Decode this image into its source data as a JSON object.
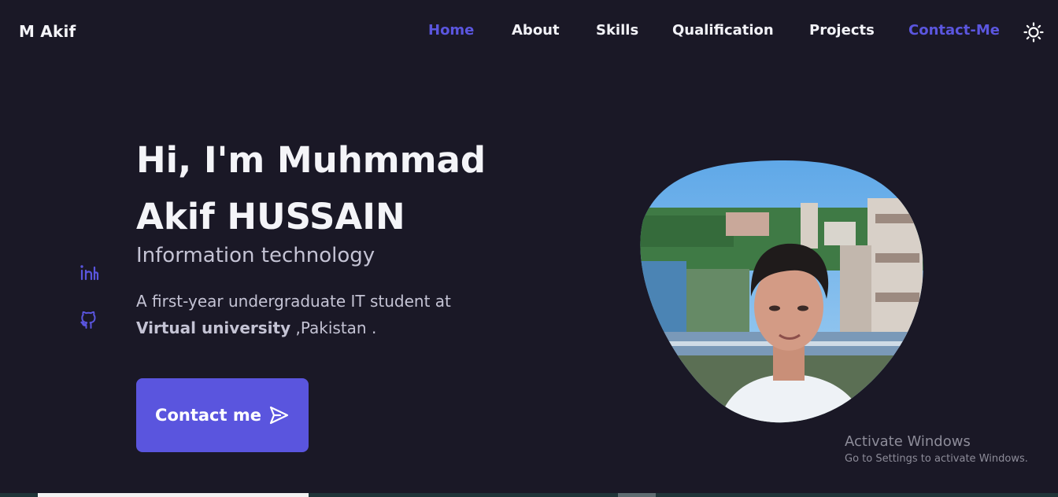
{
  "header": {
    "logo": "M Akif",
    "nav": [
      {
        "label": "Home",
        "active": true
      },
      {
        "label": "About",
        "active": false
      },
      {
        "label": "Skills",
        "active": false
      },
      {
        "label": "Qualification",
        "active": false
      },
      {
        "label": "Projects",
        "active": false
      },
      {
        "label": "Contact-Me",
        "active": true
      }
    ],
    "theme_icon": "sun-icon"
  },
  "social": [
    {
      "icon": "linkedin-icon"
    },
    {
      "icon": "github-icon"
    }
  ],
  "hero": {
    "title_line1": "Hi, I'm Muhmmad",
    "title_line2": "Akif HUSSAIN",
    "subtitle": "Information technology",
    "desc_part1": "A first-year undergraduate IT student at",
    "desc_bold": "Virtual university",
    "desc_part2": " ,Pakistan .",
    "button_label": "Contact me",
    "button_icon": "send-icon"
  },
  "watermark": {
    "title": "Activate Windows",
    "subtitle": "Go to Settings to activate Windows."
  },
  "colors": {
    "background": "#1a1826",
    "accent": "#5a55de",
    "text": "#f2f2f7",
    "muted": "#c4c3d4"
  }
}
